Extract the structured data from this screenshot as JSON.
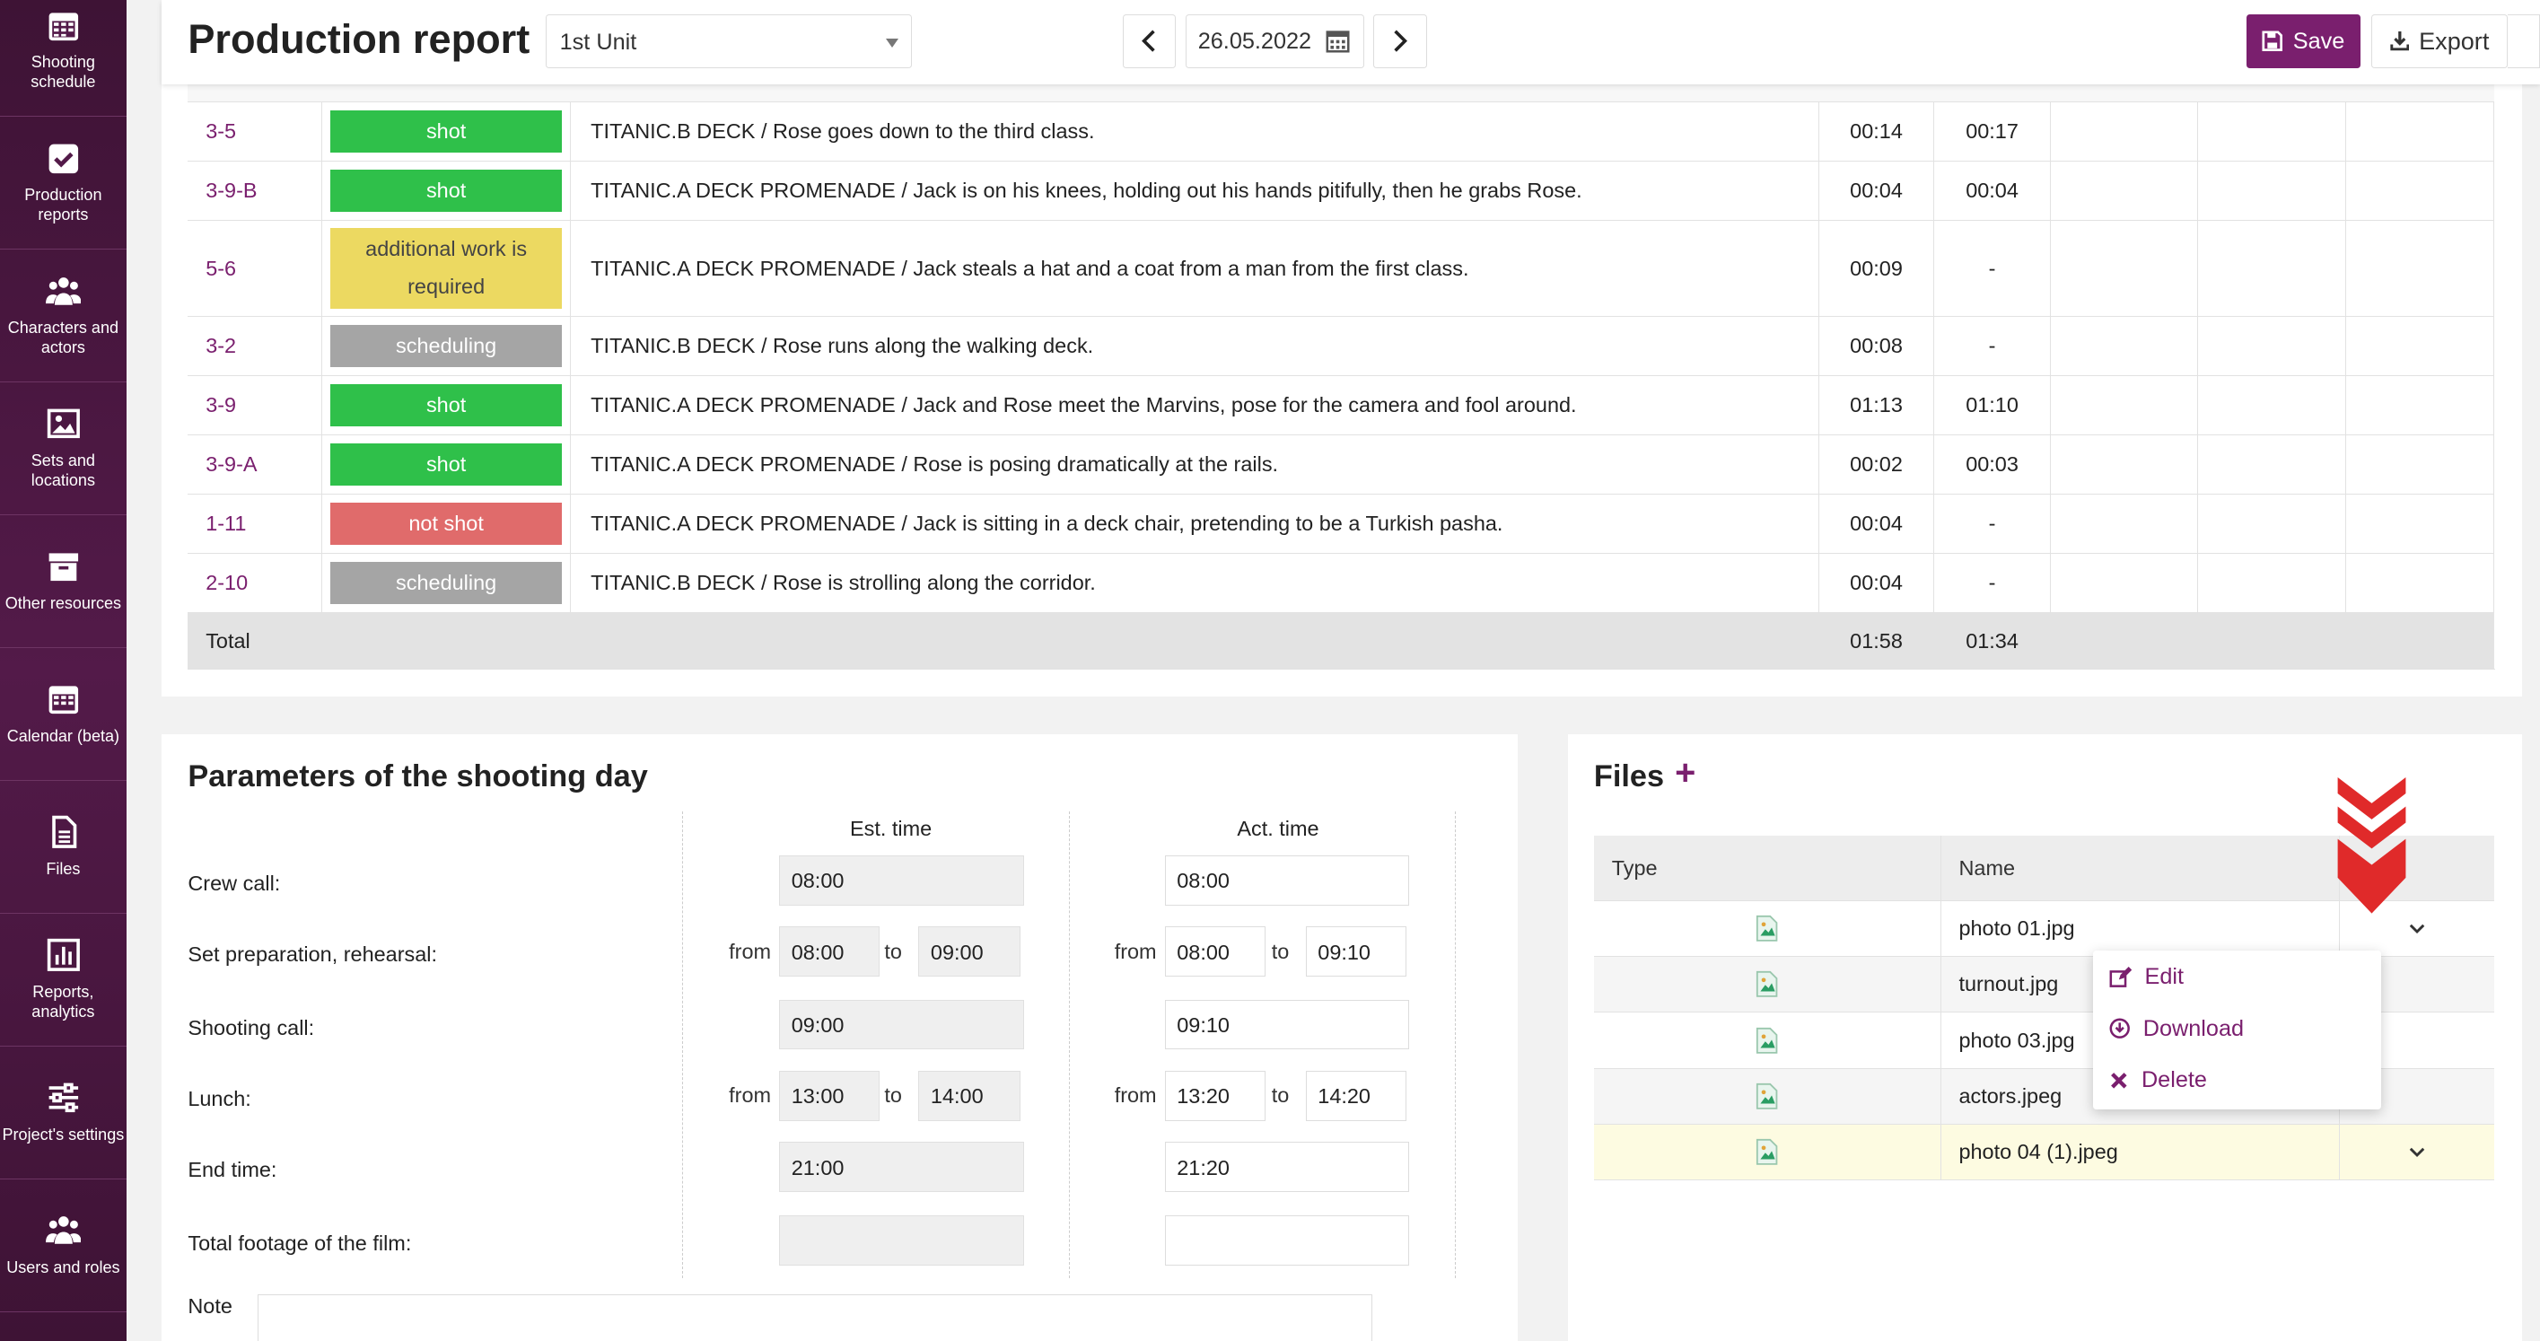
{
  "sidebar": {
    "items": [
      {
        "label": "Shooting schedule",
        "icon": "calendar-grid-icon"
      },
      {
        "label": "Production reports",
        "icon": "checkbox-icon"
      },
      {
        "label": "Characters and actors",
        "icon": "people-icon"
      },
      {
        "label": "Sets and locations",
        "icon": "image-icon"
      },
      {
        "label": "Other resources",
        "icon": "archive-icon"
      },
      {
        "label": "Calendar (beta)",
        "icon": "calendar-icon"
      },
      {
        "label": "Files",
        "icon": "file-icon"
      },
      {
        "label": "Reports, analytics",
        "icon": "bar-chart-icon"
      },
      {
        "label": "Project's settings",
        "icon": "sliders-icon"
      },
      {
        "label": "Users and roles",
        "icon": "users-icon"
      }
    ]
  },
  "header": {
    "title": "Production report",
    "unit_select": "1st Unit",
    "date": "26.05.2022",
    "save_label": "Save",
    "export_label": "Export",
    "accent": "#7a1f6e"
  },
  "scenes": {
    "rows": [
      {
        "num": "3-5",
        "status": "shot",
        "desc": "TITANIC.B DECK / Rose goes down to the third class.",
        "est": "00:14",
        "act": "00:17"
      },
      {
        "num": "3-9-B",
        "status": "shot",
        "desc": "TITANIC.A DECK PROMENADE / Jack is on his knees, holding out his hands pitifully, then he grabs Rose.",
        "est": "00:04",
        "act": "00:04"
      },
      {
        "num": "5-6",
        "status": "additional work is required",
        "desc": "TITANIC.A DECK PROMENADE / Jack steals a hat and a coat from a man from the first class.",
        "est": "00:09",
        "act": "-"
      },
      {
        "num": "3-2",
        "status": "scheduling",
        "desc": "TITANIC.B DECK / Rose runs along the walking deck.",
        "est": "00:08",
        "act": "-"
      },
      {
        "num": "3-9",
        "status": "shot",
        "desc": "TITANIC.A DECK PROMENADE / Jack and Rose meet the Marvins, pose for the camera and fool around.",
        "est": "01:13",
        "act": "01:10"
      },
      {
        "num": "3-9-A",
        "status": "shot",
        "desc": "TITANIC.A DECK PROMENADE / Rose is posing dramatically at the rails.",
        "est": "00:02",
        "act": "00:03"
      },
      {
        "num": "1-11",
        "status": "not shot",
        "desc": "TITANIC.A DECK PROMENADE / Jack is sitting in a deck chair, pretending to be a Turkish pasha.",
        "est": "00:04",
        "act": "-"
      },
      {
        "num": "2-10",
        "status": "scheduling",
        "desc": "TITANIC.B DECK / Rose is strolling along the corridor.",
        "est": "00:04",
        "act": "-"
      }
    ],
    "total_label": "Total",
    "total_est": "01:58",
    "total_act": "01:34",
    "status_colors": {
      "shot": "#2fc04a",
      "scheduling": "#a5a5a5",
      "not shot": "#e06b6b",
      "additional work is required": "#ecd961"
    }
  },
  "params": {
    "title": "Parameters of the shooting day",
    "est_header": "Est. time",
    "act_header": "Act. time",
    "from_label": "from",
    "to_label": "to",
    "crew_call": {
      "label": "Crew call:",
      "est": "08:00",
      "act": "08:00"
    },
    "set_prep": {
      "label": "Set preparation, rehearsal:",
      "est_from": "08:00",
      "est_to": "09:00",
      "act_from": "08:00",
      "act_to": "09:10"
    },
    "shooting_call": {
      "label": "Shooting call:",
      "est": "09:00",
      "act": "09:10"
    },
    "lunch": {
      "label": "Lunch:",
      "est_from": "13:00",
      "est_to": "14:00",
      "act_from": "13:20",
      "act_to": "14:20"
    },
    "end_time": {
      "label": "End time:",
      "est": "21:00",
      "act": "21:20"
    },
    "footage": {
      "label": "Total footage of the film:",
      "est": "",
      "act": ""
    },
    "note_label": "Note"
  },
  "files": {
    "title": "Files",
    "add_symbol": "+",
    "col_type": "Type",
    "col_name": "Name",
    "rows": [
      {
        "name": "photo 01.jpg"
      },
      {
        "name": "turnout.jpg"
      },
      {
        "name": "photo 03.jpg"
      },
      {
        "name": "actors.jpeg"
      },
      {
        "name": "photo 04 (1).jpeg"
      }
    ],
    "menu": {
      "edit": "Edit",
      "download": "Download",
      "delete": "Delete"
    }
  }
}
